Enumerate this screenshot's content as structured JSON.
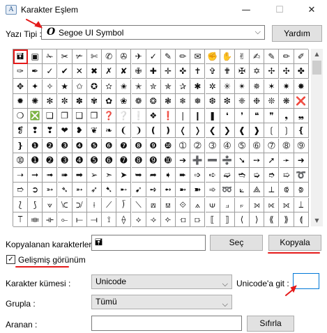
{
  "window": {
    "title": "Karakter Eşlem",
    "min_glyph": "—",
    "max_glyph": "☐",
    "close_glyph": "✕"
  },
  "font": {
    "label": "Yazı Tipi :",
    "glyph": "O",
    "value": "Segoe UI Symbol",
    "help_label": "Yardım"
  },
  "grid": {
    "cols": 20,
    "rows": 12,
    "selected_index": 0,
    "chars": [
      "🖬",
      "▣",
      "✁",
      "✂",
      "✃",
      "✄",
      "✆",
      "✇",
      "✈",
      "✓",
      "✎",
      "✏",
      "✉",
      "✊",
      "✋",
      "✌",
      "✍",
      "✎",
      "✏",
      "✐",
      "✑",
      "✒",
      "✓",
      "✔",
      "✕",
      "✖",
      "✗",
      "✘",
      "✙",
      "✚",
      "✛",
      "✜",
      "✝",
      "✞",
      "✟",
      "✠",
      "✡",
      "✢",
      "✣",
      "✤",
      "✥",
      "✦",
      "✧",
      "★",
      "✩",
      "✪",
      "✫",
      "✬",
      "✭",
      "✮",
      "✯",
      "✰",
      "✱",
      "✲",
      "✳",
      "✴",
      "✵",
      "✶",
      "✷",
      "✸",
      "✹",
      "✺",
      "✻",
      "✼",
      "✽",
      "✾",
      "✿",
      "❀",
      "❁",
      "❂",
      "❃",
      "❄",
      "❅",
      "❆",
      "❇",
      "❈",
      "❉",
      "❊",
      "❋",
      "❌",
      "❍",
      "❎",
      "❏",
      "❐",
      "❑",
      "❒",
      "❓",
      "❔",
      "❕",
      "❖",
      "❗",
      "❘",
      "❙",
      "❚",
      "❛",
      "❜",
      "❝",
      "❞",
      "❟",
      "❠",
      "❡",
      "❢",
      "❣",
      "❤",
      "❥",
      "❦",
      "❧",
      "❨",
      "❩",
      "❪",
      "❫",
      "❬",
      "❭",
      "❮",
      "❯",
      "❰",
      "❱",
      "❲",
      "❳",
      "❴",
      "❵",
      "❶",
      "❷",
      "❸",
      "❹",
      "❺",
      "❻",
      "❼",
      "❽",
      "❾",
      "❿",
      "➀",
      "➁",
      "➂",
      "➃",
      "➄",
      "➅",
      "➆",
      "➇",
      "➈",
      "➉",
      "➊",
      "➋",
      "➌",
      "➍",
      "➎",
      "➏",
      "➐",
      "➑",
      "➒",
      "➓",
      "➔",
      "➕",
      "➖",
      "➗",
      "➘",
      "➙",
      "➚",
      "➛",
      "➜",
      "➝",
      "➞",
      "➟",
      "➠",
      "➡",
      "➢",
      "➣",
      "➤",
      "➥",
      "➦",
      "➧",
      "➨",
      "➩",
      "➪",
      "➫",
      "➬",
      "➭",
      "➮",
      "➯",
      "➰",
      "➱",
      "➲",
      "➳",
      "➴",
      "➵",
      "➶",
      "➷",
      "➸",
      "➹",
      "➺",
      "➻",
      "➼",
      "➽",
      "➾",
      "➿",
      "⟀",
      "⟁",
      "⟂",
      "⟃",
      "⟄",
      "⟅",
      "⟆",
      "⟇",
      "⟈",
      "⟉",
      "⟊",
      "⟋",
      "⟌",
      "⟍",
      "⟎",
      "⟏",
      "⟐",
      "⟑",
      "⟒",
      "⟓",
      "⟔",
      "⟕",
      "⟖",
      "⟗",
      "⟘",
      "⟙",
      "⟚",
      "⟛",
      "⟜",
      "⟝",
      "⟞",
      "⟟",
      "⟠",
      "⟡",
      "⟢",
      "⟣",
      "⟤",
      "⟥",
      "⟦",
      "⟧",
      "⟨",
      "⟩",
      "⟪",
      "⟫",
      "⟬"
    ]
  },
  "copy": {
    "label": "Kopyalanan karakterler :",
    "value": "🖬",
    "select_label": "Seç",
    "copy_label": "Kopyala"
  },
  "advanced": {
    "label": "Gelişmiş görünüm",
    "checkmark": "✓"
  },
  "charset": {
    "label": "Karakter kümesi :",
    "value": "Unicode"
  },
  "unicode": {
    "label": "Unicode'a git :",
    "value": ""
  },
  "group": {
    "label": "Grupla :",
    "value": "Tümü"
  },
  "search": {
    "label": "Aranan :",
    "value": "",
    "button_label": "Sıfırla"
  },
  "arrow_glyphs": {
    "dropdown": "⌵",
    "scroll_up": "▲",
    "scroll_down": "▼"
  },
  "colors": {
    "annotation_red": "#e41a1a",
    "focus_blue": "#0078d7"
  }
}
